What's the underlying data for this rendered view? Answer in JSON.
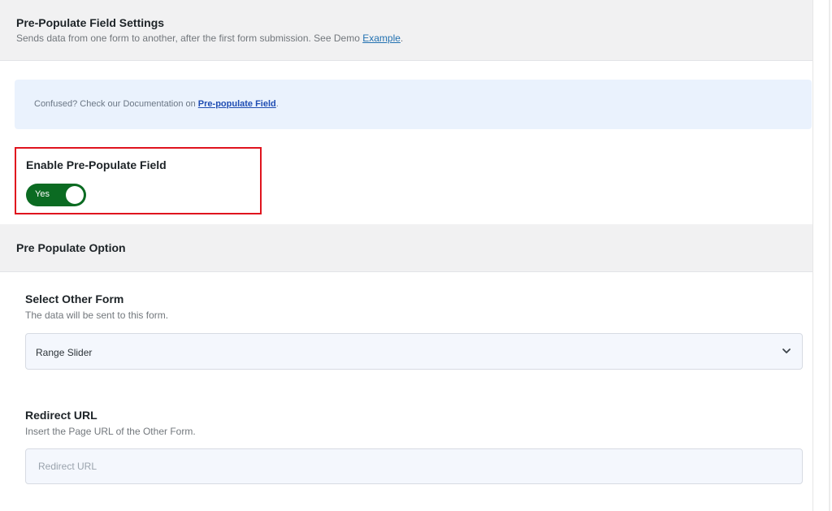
{
  "header": {
    "title": "Pre-Populate Field Settings",
    "description": "Sends data from one form to another, after the first form submission. See Demo",
    "example_link": "Example",
    "trailing": "."
  },
  "notice": {
    "text": "Confused? Check our Documentation on",
    "link": "Pre-populate Field",
    "trailing": "."
  },
  "enable": {
    "label": "Enable Pre-Populate Field",
    "toggle_label": "Yes",
    "toggle_on": true,
    "toggle_color": "#0b6b22",
    "highlight_color": "#e0141e"
  },
  "section": {
    "title": "Pre Populate Option"
  },
  "select_form": {
    "label": "Select Other Form",
    "description": "The data will be sent to this form.",
    "value": "Range Slider",
    "icon": "chevron-down-icon"
  },
  "redirect_url": {
    "label": "Redirect URL",
    "description": "Insert the Page URL of the Other Form.",
    "placeholder": "Redirect URL",
    "value": ""
  }
}
